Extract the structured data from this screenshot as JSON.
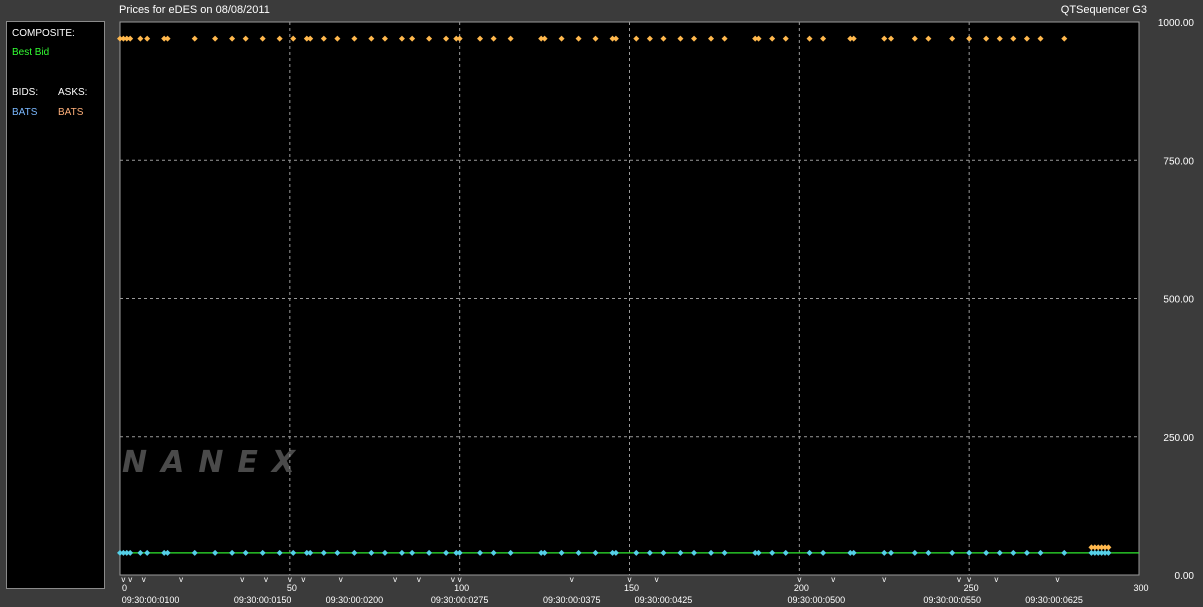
{
  "header": {
    "title": "Prices for  eDES  on  08/08/2011",
    "app_name": "QTSequencer G3"
  },
  "legend": {
    "composite_label": "COMPOSITE:",
    "best_bid_label": "Best Bid",
    "bids_label": "BIDS:",
    "asks_label": "ASKS:",
    "bid_exchange": "BATS",
    "ask_exchange": "BATS"
  },
  "watermark": "NANEX",
  "colors": {
    "background": "#000000",
    "grid": "#9a9a9a",
    "best_bid_line": "#2ee82e",
    "bid_points": "#55d0e8",
    "ask_points": "#ffb84d",
    "best_bid_text": "#33ff33",
    "bid_text": "#7ab8ff",
    "ask_text": "#ffb07a"
  },
  "chart_data": {
    "type": "scatter",
    "title": "Prices for  eDES  on  08/08/2011",
    "xlim": [
      0,
      300
    ],
    "ylim": [
      0,
      1000
    ],
    "x_ticks": [
      0,
      50,
      100,
      150,
      200,
      250,
      300
    ],
    "y_ticks": [
      "0.00",
      "250.00",
      "500.00",
      "750.00",
      "1000.00"
    ],
    "time_labels": [
      {
        "x": 9,
        "label": "09:30:00:0100"
      },
      {
        "x": 42,
        "label": "09:30:00:0150"
      },
      {
        "x": 69,
        "label": "09:30:00:0200"
      },
      {
        "x": 100,
        "label": "09:30:00:0275"
      },
      {
        "x": 133,
        "label": "09:30:00:0375"
      },
      {
        "x": 160,
        "label": "09:30:00:0425"
      },
      {
        "x": 205,
        "label": "09:30:00:0500"
      },
      {
        "x": 245,
        "label": "09:30:00:0550"
      },
      {
        "x": 275,
        "label": "09:30:00:0625"
      }
    ],
    "time_markers": [
      1,
      3,
      7,
      18,
      36,
      43,
      50,
      54,
      65,
      81,
      88,
      98,
      100,
      133,
      150,
      158,
      200,
      210,
      225,
      247,
      250,
      258,
      276
    ],
    "series": [
      {
        "name": "Best Bid",
        "kind": "line",
        "x": [
          0,
          300
        ],
        "y": [
          40,
          40
        ]
      },
      {
        "name": "BATS",
        "kind": "bid",
        "x": [
          0,
          1,
          2,
          3,
          6,
          8,
          13,
          14,
          22,
          28,
          33,
          37,
          42,
          47,
          51,
          55,
          56,
          60,
          64,
          69,
          74,
          78,
          83,
          86,
          91,
          96,
          99,
          100,
          106,
          110,
          115,
          124,
          125,
          130,
          135,
          140,
          145,
          146,
          152,
          156,
          160,
          165,
          169,
          174,
          178,
          187,
          188,
          192,
          196,
          203,
          207,
          215,
          216,
          225,
          227,
          234,
          238,
          245,
          250,
          255,
          259,
          263,
          267,
          271,
          278,
          286,
          287,
          288,
          289,
          290,
          291
        ],
        "y": [
          40,
          40,
          40,
          40,
          40,
          40,
          40,
          40,
          40,
          40,
          40,
          40,
          40,
          40,
          40,
          40,
          40,
          40,
          40,
          40,
          40,
          40,
          40,
          40,
          40,
          40,
          40,
          40,
          40,
          40,
          40,
          40,
          40,
          40,
          40,
          40,
          40,
          40,
          40,
          40,
          40,
          40,
          40,
          40,
          40,
          40,
          40,
          40,
          40,
          40,
          40,
          40,
          40,
          40,
          40,
          40,
          40,
          40,
          40,
          40,
          40,
          40,
          40,
          40,
          40,
          40,
          40,
          40,
          40,
          40,
          40
        ]
      },
      {
        "name": "BATS",
        "kind": "ask",
        "x": [
          0,
          1,
          2,
          3,
          6,
          8,
          13,
          14,
          22,
          28,
          33,
          37,
          42,
          47,
          51,
          55,
          56,
          60,
          64,
          69,
          74,
          78,
          83,
          86,
          91,
          96,
          99,
          100,
          106,
          110,
          115,
          124,
          125,
          130,
          135,
          140,
          145,
          146,
          152,
          156,
          160,
          165,
          169,
          174,
          178,
          187,
          188,
          192,
          196,
          203,
          207,
          215,
          216,
          225,
          227,
          234,
          238,
          245,
          250,
          255,
          259,
          263,
          267,
          271,
          278,
          286,
          287,
          288,
          289,
          290,
          291
        ],
        "y": [
          970,
          970,
          970,
          970,
          970,
          970,
          970,
          970,
          970,
          970,
          970,
          970,
          970,
          970,
          970,
          970,
          970,
          970,
          970,
          970,
          970,
          970,
          970,
          970,
          970,
          970,
          970,
          970,
          970,
          970,
          970,
          970,
          970,
          970,
          970,
          970,
          970,
          970,
          970,
          970,
          970,
          970,
          970,
          970,
          970,
          970,
          970,
          970,
          970,
          970,
          970,
          970,
          970,
          970,
          970,
          970,
          970,
          970,
          970,
          970,
          970,
          970,
          970,
          970,
          970,
          50,
          50,
          50,
          50,
          50,
          50
        ]
      }
    ]
  }
}
